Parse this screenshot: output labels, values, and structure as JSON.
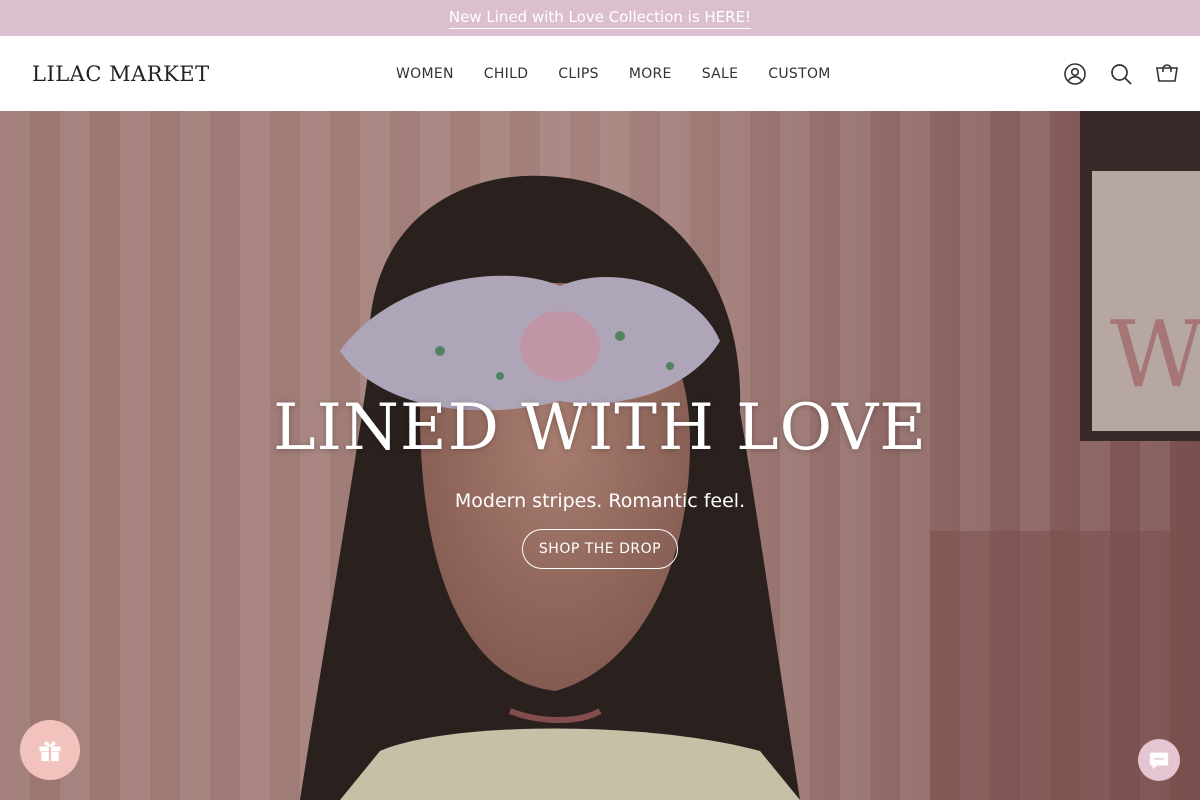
{
  "announcement": {
    "text": "New Lined with Love Collection is HERE!"
  },
  "header": {
    "logo": "LILAC MARKET",
    "nav": [
      "WOMEN",
      "CHILD",
      "CLIPS",
      "MORE",
      "SALE",
      "CUSTOM"
    ],
    "icons": [
      "account-icon",
      "search-icon",
      "cart-icon"
    ]
  },
  "hero": {
    "title": "LINED WITH LOVE",
    "subtitle": "Modern stripes. Romantic feel.",
    "button": "SHOP THE DROP"
  },
  "widgets": {
    "rewards_icon": "gift-icon",
    "chat_icon": "chat-icon"
  },
  "colors": {
    "announcement_bg": "#dcbfce",
    "rewards_bg": "#f2c3bd",
    "chat_bg": "#e4c6d3"
  }
}
